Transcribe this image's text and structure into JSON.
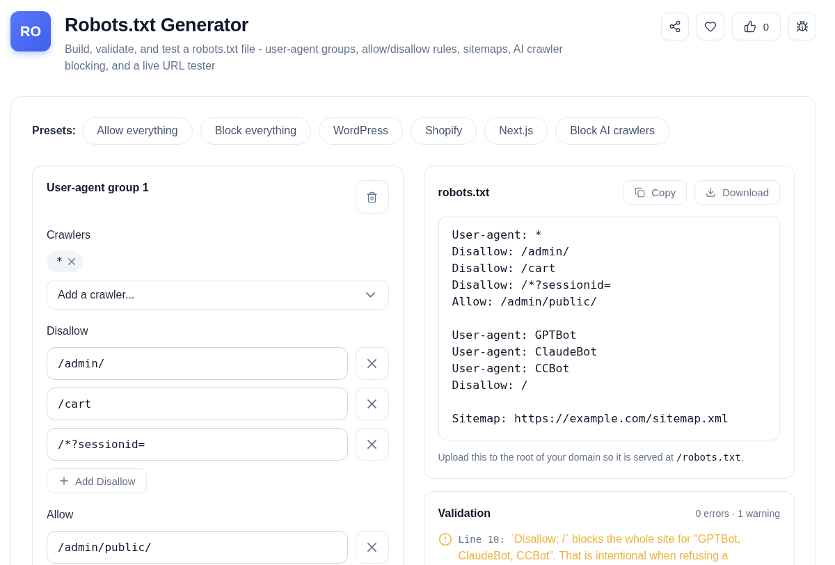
{
  "header": {
    "logo": "RO",
    "title": "Robots.txt Generator",
    "description": "Build, validate, and test a robots.txt file - user-agent groups, allow/disallow rules, sitemaps, AI crawler blocking, and a live URL tester",
    "actions": [
      {
        "kind": "share"
      },
      {
        "kind": "favorite"
      },
      {
        "kind": "like",
        "count": "0"
      },
      {
        "kind": "report-bug"
      }
    ]
  },
  "presets": {
    "label": "Presets:",
    "items": [
      "Allow everything",
      "Block everything",
      "WordPress",
      "Shopify",
      "Next.js",
      "Block AI crawlers"
    ]
  },
  "group": {
    "title": "User-agent group 1",
    "crawlers": {
      "label": "Crawlers",
      "tags": [
        "*"
      ],
      "select": {
        "placeholder": "Add a crawler..."
      }
    },
    "rule_sections": [
      {
        "label": "Disallow",
        "rules": [
          "/admin/",
          "/cart",
          "/*?sessionid="
        ],
        "add_button": "Add Disallow"
      },
      {
        "label": "Allow",
        "rules": [
          "/admin/public/"
        ]
      }
    ]
  },
  "output": {
    "title": "robots.txt",
    "buttons": [
      {
        "kind": "copy",
        "label": "Copy"
      },
      {
        "kind": "download",
        "label": "Download"
      }
    ],
    "content": "User-agent: *\nDisallow: /admin/\nDisallow: /cart\nDisallow: /*?sessionid=\nAllow: /admin/public/\n\nUser-agent: GPTBot\nUser-agent: ClaudeBot\nUser-agent: CCBot\nDisallow: /\n\nSitemap: https://example.com/sitemap.xml",
    "note": {
      "text": "Upload this to the root of your domain so it is served at",
      "code": "/robots.txt",
      "end": "."
    }
  },
  "validation": {
    "title": "Validation",
    "summary": "0 errors · 1 warning",
    "issues": [
      {
        "kind": "warning",
        "line": "Line 10:",
        "message": "`Disallow: /` blocks the whole site for \"GPTBot, ClaudeBot, CCBot\". That is intentional when refusing a"
      }
    ]
  }
}
